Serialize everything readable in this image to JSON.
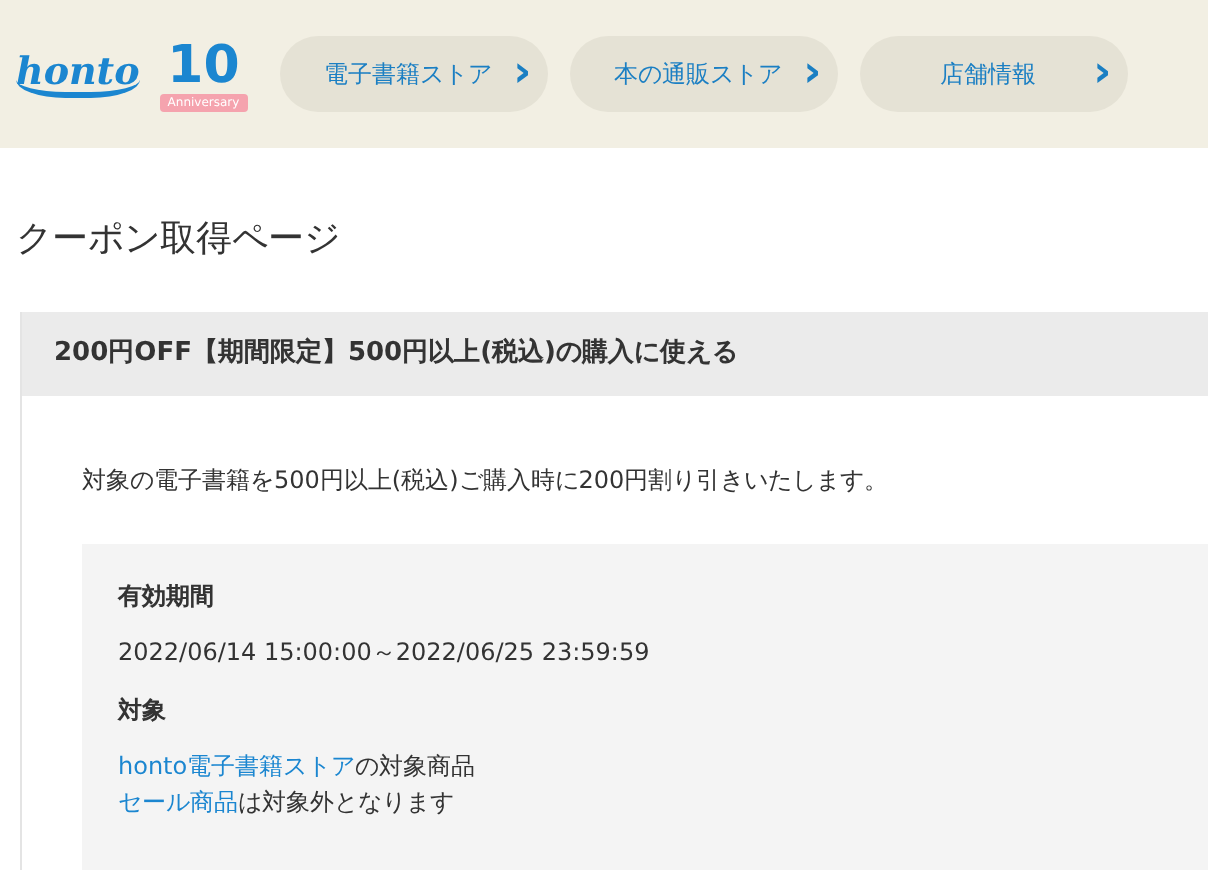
{
  "header": {
    "logo": "honto",
    "badge": {
      "number": "10",
      "ribbon": "Anniversary"
    },
    "nav": [
      {
        "label": "電子書籍ストア",
        "icon": "›"
      },
      {
        "label": "本の通販ストア",
        "icon": "›"
      },
      {
        "label": "店舗情報",
        "icon": "›"
      }
    ]
  },
  "page_title": "クーポン取得ページ",
  "coupon": {
    "title": "200円OFF【期間限定】500円以上(税込)の購入に使える",
    "description": "対象の電子書籍を500円以上(税込)ご購入時に200円割り引きいたします。",
    "details": [
      {
        "heading": "有効期間",
        "lines": [
          [
            {
              "text": "2022/06/14 15:00:00～2022/06/25 23:59:59",
              "link": false
            }
          ]
        ]
      },
      {
        "heading": "対象",
        "lines": [
          [
            {
              "text": "honto電子書籍ストア",
              "link": true
            },
            {
              "text": "の対象商品",
              "link": false
            }
          ],
          [
            {
              "text": "セール商品",
              "link": true
            },
            {
              "text": "は対象外となります",
              "link": false
            }
          ]
        ]
      }
    ]
  }
}
